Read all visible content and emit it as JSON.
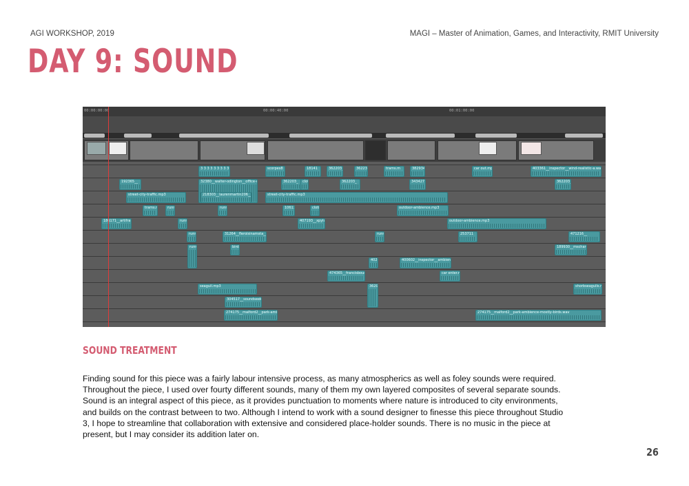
{
  "header": {
    "left": "AGI WORKSHOP, 2019",
    "right": "MAGI – Master of Animation, Games, and Interactivity, RMIT University"
  },
  "title": "DAY 9: SOUND",
  "editor": {
    "ruler_ticks": [
      "00:00:00:00",
      "00:00:40:00",
      "00:01:00:00"
    ],
    "clips": [
      {
        "label": "3 3 3 3 3 3 3 3 3 3",
        "lane": 0
      },
      {
        "label": "scorpes8",
        "lane": 0
      },
      {
        "label": "18141",
        "lane": 0
      },
      {
        "label": "362203__",
        "lane": 0
      },
      {
        "label": "36223",
        "lane": 0
      },
      {
        "label": "trams.m",
        "lane": 0
      },
      {
        "label": "382934_",
        "lane": 0
      },
      {
        "label": "car out.mp3",
        "lane": 0
      },
      {
        "label": "403361__inspector__wind-realistic-a.wav",
        "lane": 0
      },
      {
        "label": "192365__",
        "lane": 1
      },
      {
        "label": "32380__walter-odington__office-with",
        "lane": 1
      },
      {
        "label": "362203_",
        "lane": 1
      },
      {
        "label": "cloth",
        "lane": 1
      },
      {
        "label": "362203_",
        "lane": 1
      },
      {
        "label": "343427",
        "lane": 1
      },
      {
        "label": "362203_",
        "lane": 1
      },
      {
        "label": "street-city-traffic.mp3",
        "lane": 2
      },
      {
        "label": "218303__laurenmartin206__",
        "lane": 2
      },
      {
        "label": "street-city-traffic.mp3",
        "lane": 2
      },
      {
        "label": "trams.m",
        "lane": 3
      },
      {
        "label": "runni",
        "lane": 3
      },
      {
        "label": "runni",
        "lane": 3
      },
      {
        "label": "10611",
        "lane": 3
      },
      {
        "label": "cloth",
        "lane": 3
      },
      {
        "label": "outdoor-ambience.mp3",
        "lane": 3
      },
      {
        "label": "186171__artifra",
        "lane": 4
      },
      {
        "label": "runni",
        "lane": 4
      },
      {
        "label": "407193__xpylothis",
        "lane": 4
      },
      {
        "label": "outdoor-ambience.mp3",
        "lane": 4
      },
      {
        "label": "runni",
        "lane": 5
      },
      {
        "label": "31264__fleroisinamsta__3",
        "lane": 5
      },
      {
        "label": "runni",
        "lane": 5
      },
      {
        "label": "253711",
        "lane": 5
      },
      {
        "label": "471216__",
        "lane": 5
      },
      {
        "label": "runni",
        "lane": 6
      },
      {
        "label": "bird",
        "lane": 6
      },
      {
        "label": "189930__mscharw",
        "lane": 6
      },
      {
        "label": "40216",
        "lane": 7
      },
      {
        "label": "400602__inspector__ambience",
        "lane": 7
      },
      {
        "label": "474365__francisbourgcould",
        "lane": 8
      },
      {
        "label": "car enter.mp",
        "lane": 8
      },
      {
        "label": "seagull.mp3",
        "lane": 9
      },
      {
        "label": "362077",
        "lane": 9
      },
      {
        "label": "shorbseagulls.mp",
        "lane": 9
      },
      {
        "label": "304517__soundseeke",
        "lane": 10
      },
      {
        "label": "274175__malford2__park-ambien",
        "lane": 11
      },
      {
        "label": "274175__malford2__park-ambience-mostly-birds.wav",
        "lane": 11
      }
    ]
  },
  "section_title": "SOUND TREATMENT",
  "body_text": "Finding sound for this piece was a fairly labour intensive process, as many atmospherics as well as foley sounds were required. Throughout the piece, I used over fourty different sounds, many of them my own layered composites of several separate sounds. Sound is an integral aspect of this piece, as it provides punctuation to moments where nature is introduced to city environments, and builds on the contrast between to two. Although I intend to work with a sound designer to finesse this piece throughout Studio 3, I hope to streamline that collaboration with extensive and considered place-holder sounds. There is no music in the piece at present, but I may consider its addition later on.",
  "page_number": "26",
  "colors": {
    "accent": "#d45c71",
    "clip": "#4a9aa0",
    "playhead": "#e23a3a"
  }
}
